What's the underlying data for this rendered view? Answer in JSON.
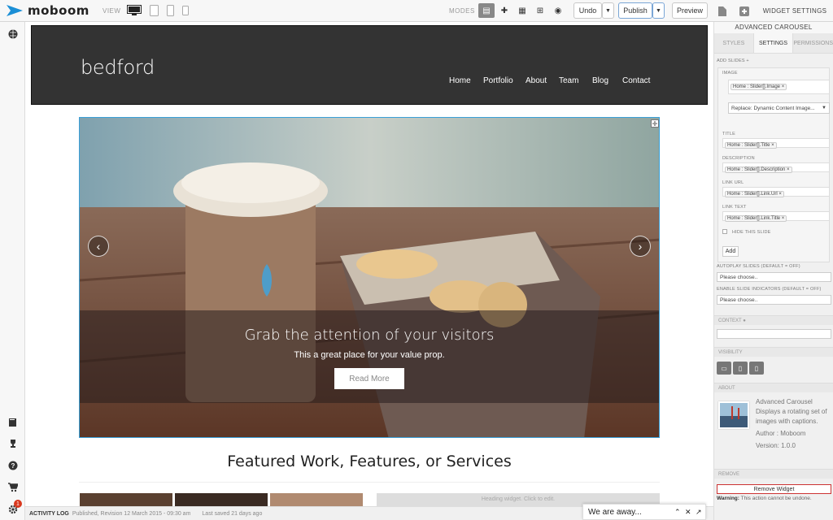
{
  "app": {
    "logo_text": "moboom"
  },
  "toolbar": {
    "view_label": "VIEW",
    "modes_label": "MODES",
    "undo_label": "Undo",
    "publish_label": "Publish",
    "preview_label": "Preview",
    "widget_settings_label": "WIDGET SETTINGS"
  },
  "site": {
    "brand": "bedford",
    "nav": [
      "Home",
      "Portfolio",
      "About",
      "Team",
      "Blog",
      "Contact"
    ]
  },
  "carousel": {
    "title": "Grab the attention of your visitors",
    "subtitle": "This a great place for your value prop.",
    "button": "Read More"
  },
  "featured_heading": "Featured Work, Features, or Services",
  "heading_widget_text": "Heading widget. Click to edit.",
  "activity": {
    "label": "ACTIVITY LOG",
    "published": "Published, Revision 12 March 2015 - 09:30 am",
    "last_saved": "Last saved 21 days ago"
  },
  "chat": {
    "text": "We are away..."
  },
  "panel": {
    "title": "ADVANCED CAROUSEL",
    "tabs": [
      "STYLES",
      "SETTINGS",
      "PERMISSIONS"
    ],
    "add_slides": "ADD SLIDES +",
    "image_label": "IMAGE",
    "image_tag": "Home : Slider[].Image",
    "replace_select": "Replace: Dynamic Content Image...",
    "title_label": "TITLE",
    "title_tag": "Home : Slider[].Title",
    "description_label": "DESCRIPTION",
    "description_tag": "Home : Slider[].Description",
    "link_url_label": "LINK URL",
    "link_url_tag": "Home : Slider[].Link.Url",
    "link_text_label": "LINK TEXT",
    "link_text_tag": "Home : Slider[].Link.Title",
    "hide_slide": "HIDE THIS SLIDE",
    "add_button": "Add",
    "autoplay_label": "AUTOPLAY SLIDES (DEFAULT = OFF)",
    "autoplay_value": "Please choose..",
    "indicators_label": "ENABLE SLIDE INDICATORS (DEFAULT = OFF)",
    "indicators_value": "Please choose..",
    "context_label": "CONTEXT",
    "visibility_label": "VISIBILITY",
    "about_label": "ABOUT",
    "about_name": "Advanced Carousel",
    "about_desc": "Displays a rotating set of images with captions.",
    "about_author": "Author : Moboom",
    "about_version": "Version: 1.0.0",
    "remove_label": "REMOVE",
    "remove_button": "Remove Widget",
    "warning_bold": "Warning:",
    "warning_text": "This action cannot be undone."
  },
  "notifications": {
    "count": "1"
  }
}
